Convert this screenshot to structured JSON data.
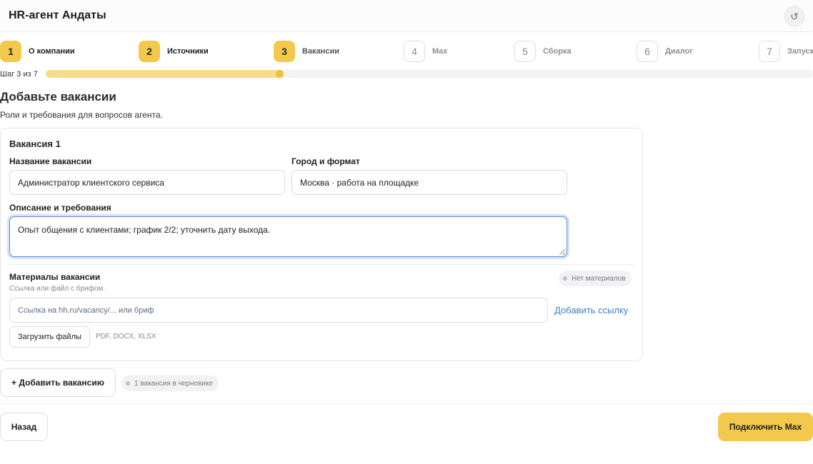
{
  "header": {
    "title": "HR-агент Андаты",
    "refresh_icon": "↺"
  },
  "steps": [
    {
      "num": "1",
      "label": "О компании",
      "state": "done"
    },
    {
      "num": "2",
      "label": "Источники",
      "state": "done"
    },
    {
      "num": "3",
      "label": "Вакансии",
      "state": "current"
    },
    {
      "num": "4",
      "label": "Max",
      "state": "todo"
    },
    {
      "num": "5",
      "label": "Сборка",
      "state": "todo"
    },
    {
      "num": "6",
      "label": "Диалог",
      "state": "todo"
    },
    {
      "num": "7",
      "label": "Запуск",
      "state": "todo"
    }
  ],
  "progress": {
    "text": "Шаг 3 из 7",
    "current_step": 3,
    "total_steps": 7,
    "fill_fraction": 0.31
  },
  "page": {
    "title": "Добавьте вакансии",
    "subtitle": "Роли и требования для вопросов агента."
  },
  "vacancy": {
    "title": "Вакансия 1",
    "name_label": "Название вакансии",
    "name_value": "Администратор клиентского сервиса",
    "city_label": "Город и формат",
    "city_value": "Москва · работа на площадке",
    "description_label": "Описание и требования",
    "description_value": "Опыт общения с клиентами; график 2/2; уточнить дату выхода.",
    "materials_title": "Материалы вакансии",
    "materials_hint": "Ссылка или файл с брифом.",
    "materials_badge": "Нет материалов",
    "link_placeholder": "Ссылка на hh.ru/vacancy/... или бриф",
    "add_link_label": "Добавить ссылку",
    "upload_label": "Загрузить файлы",
    "formats": "PDF, DOCX, XLSX"
  },
  "actions": {
    "add_vacancy_label": "+ Добавить вакансию",
    "draft_badge": "1 вакансия в черновике",
    "back_label": "Назад",
    "next_label": "Подключить Max"
  },
  "colors": {
    "accent": "#f2c94c",
    "progress_fill": "#f6dc8c",
    "link": "#3c7fc4",
    "focus_border": "#5a8fd6"
  }
}
